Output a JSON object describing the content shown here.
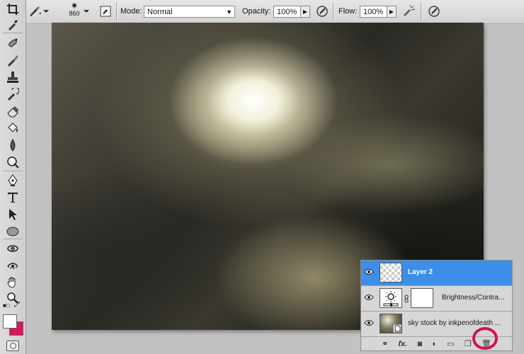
{
  "options_bar": {
    "brush_size": "860",
    "mode_label": "Mode:",
    "mode_value": "Normal",
    "opacity_label": "Opacity:",
    "opacity_value": "100%",
    "flow_label": "Flow:",
    "flow_value": "100%"
  },
  "toolbox": {
    "foreground_color": "#ffffff",
    "background_color": "#d4175f"
  },
  "layers_panel": {
    "layers": [
      {
        "name": "Layer 2",
        "visible": true,
        "selected": true
      },
      {
        "name": "Brightness/Contra...",
        "visible": true,
        "selected": false
      },
      {
        "name": "sky stock by inkpenofdeath ...",
        "visible": true,
        "selected": false
      }
    ],
    "footer_fx": "fx."
  },
  "accent_color": "#3d8ee8",
  "highlight_color": "#d6114e"
}
